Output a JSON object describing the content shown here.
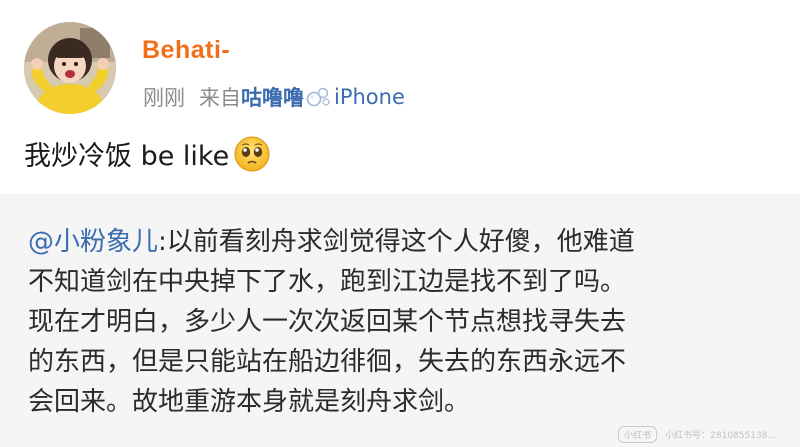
{
  "post": {
    "username": "Behati-",
    "time": "刚刚",
    "from_label": "来自",
    "client_name": "咕噜噜",
    "device": "iPhone",
    "text": "我炒冷饭 be like",
    "emoji_icon": "pleading-face-emoji"
  },
  "repost": {
    "mention": "@小粉象儿",
    "lines": [
      ":以前看刻舟求剑觉得这个人好傻，他难道",
      "不知道剑在中央掉下了水，跑到江边是找不到了吗。",
      "现在才明白，多少人一次次返回某个节点想找寻失去",
      "的东西，但是只能站在船边徘徊，失去的东西永远不",
      "会回来。故地重游本身就是刻舟求剑。"
    ]
  },
  "watermark": {
    "badge": "小红书",
    "text": "小红书号：2810855138..."
  },
  "colors": {
    "username": "#f26f1a",
    "link": "#3b6cb0",
    "meta": "#8c8c8c",
    "repost_bg": "#f5f5f5"
  }
}
